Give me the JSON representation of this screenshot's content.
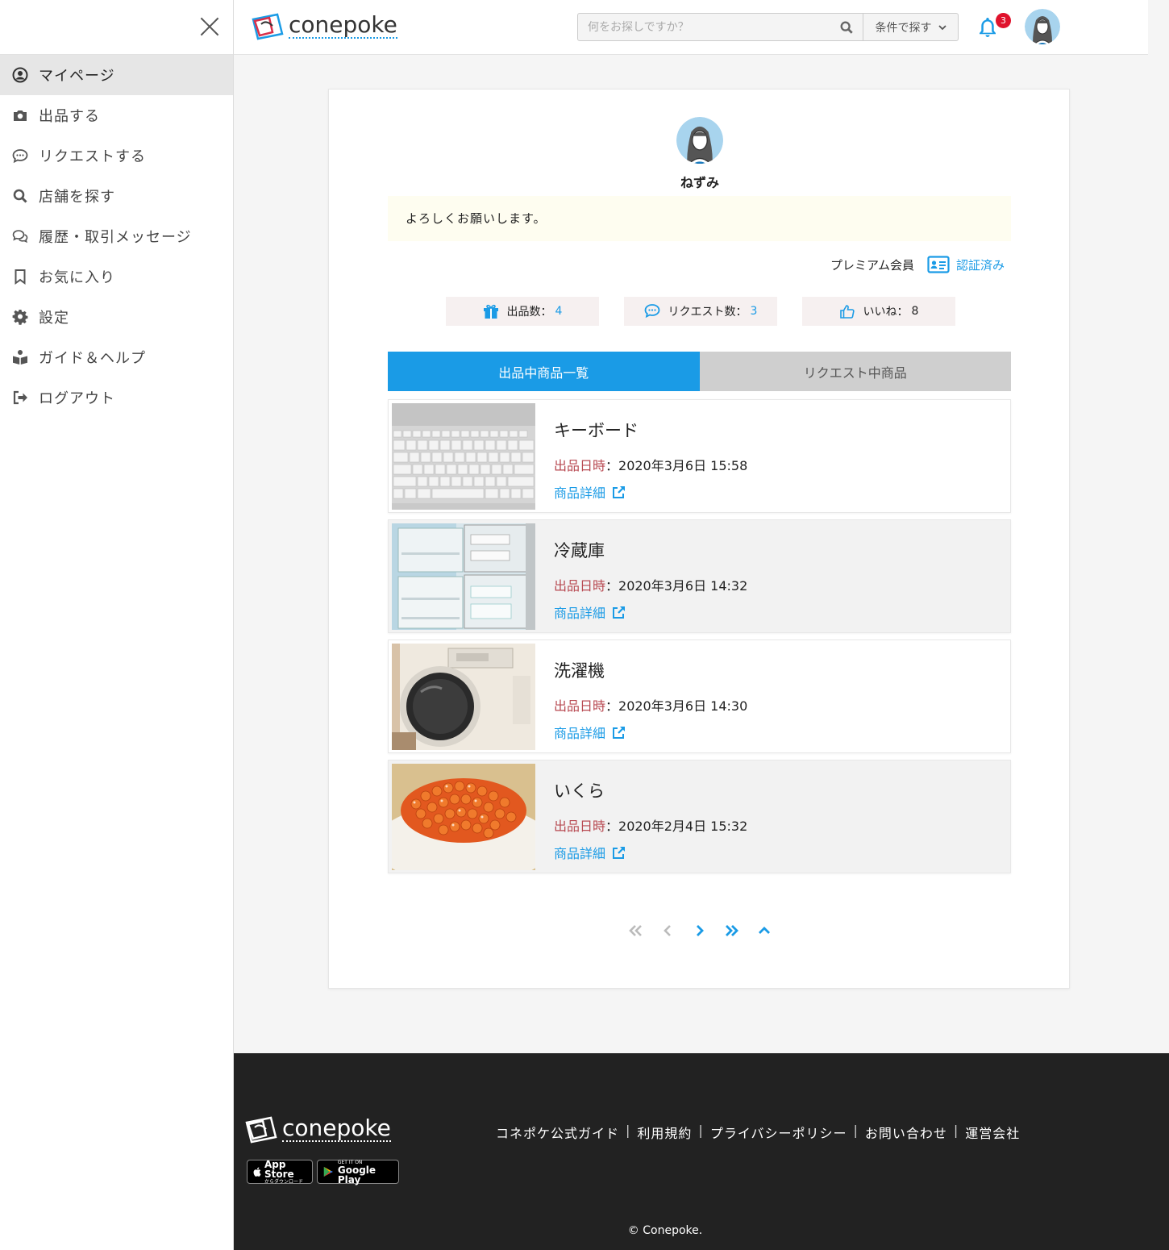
{
  "sidebar": {
    "items": [
      {
        "label": "マイページ",
        "icon": "user-circle-icon",
        "active": true
      },
      {
        "label": "出品する",
        "icon": "camera-icon"
      },
      {
        "label": "リクエストする",
        "icon": "chat-bubble-icon"
      },
      {
        "label": "店舗を探す",
        "icon": "search-icon"
      },
      {
        "label": "履歴・取引メッセージ",
        "icon": "chats-icon"
      },
      {
        "label": "お気に入り",
        "icon": "bookmark-icon"
      },
      {
        "label": "設定",
        "icon": "gear-icon"
      },
      {
        "label": "ガイド＆ヘルプ",
        "icon": "book-reader-icon"
      },
      {
        "label": "ログアウト",
        "icon": "logout-icon"
      }
    ]
  },
  "header": {
    "logo_text": "conepoke",
    "search_placeholder": "何をお探しですか？",
    "condition_button": "条件で探す",
    "notification_count": "3"
  },
  "profile": {
    "username": "ねずみ",
    "intro": "よろしくお願いします。",
    "member_type": "プレミアム会員",
    "verified_label": "認証済み",
    "stats": [
      {
        "label": "出品数：",
        "value": "4",
        "icon": "gift-icon"
      },
      {
        "label": "リクエスト数：",
        "value": "3",
        "icon": "chat-bubble-icon"
      },
      {
        "label": "いいね：",
        "value": "8",
        "icon": "thumbs-up-icon"
      }
    ]
  },
  "tabs": [
    {
      "label": "出品中商品一覧",
      "active": true
    },
    {
      "label": "リクエスト中商品",
      "active": false
    }
  ],
  "items": [
    {
      "title": "キーボード",
      "date_label": "出品日時",
      "date": "：2020年3月6日 15:58",
      "link": "商品詳細"
    },
    {
      "title": "冷蔵庫",
      "date_label": "出品日時",
      "date": "：2020年3月6日 14:32",
      "link": "商品詳細"
    },
    {
      "title": "洗濯機",
      "date_label": "出品日時",
      "date": "：2020年3月6日 14:30",
      "link": "商品詳細"
    },
    {
      "title": "いくら",
      "date_label": "出品日時",
      "date": "：2020年2月4日 15:32",
      "link": "商品詳細"
    }
  ],
  "footer": {
    "logo_text": "conepoke",
    "links": [
      "コネポケ公式ガイド",
      "利用規約",
      "プライバシーポリシー",
      "お問い合わせ",
      "運営会社"
    ],
    "app_store_small": "App Store",
    "app_store_sub": "からダウンロード",
    "google_small": "GET IT ON",
    "google_big": "Google Play",
    "copyright": "© Conepoke."
  },
  "colors": {
    "accent": "#1a9be6",
    "date_label": "#b84a52",
    "badge": "#e0122c",
    "footer_bg": "#222222"
  }
}
